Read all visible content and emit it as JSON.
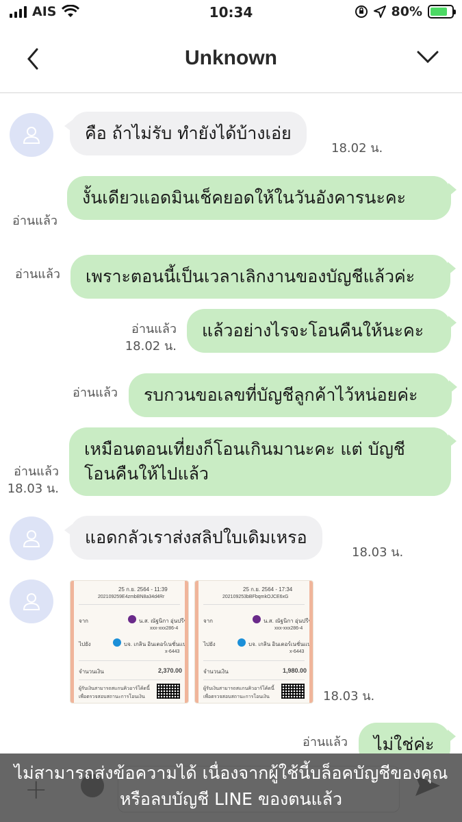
{
  "status_bar": {
    "carrier": "AIS",
    "time": "10:34",
    "battery": "80%",
    "battery_level": 0.8
  },
  "header": {
    "title": "Unknown"
  },
  "messages": [
    {
      "side": "in",
      "text": "คือ ถ้าไม่รับ ทำยังได้บ้างเอ่ย",
      "time": "18.02 น."
    },
    {
      "side": "out",
      "text": "งั้นเดียวแอดมินเช็คยอดให้ในวันอังคารนะคะ",
      "read": "อ่านแล้ว"
    },
    {
      "side": "out",
      "text": "เพราะตอนนี้เป็นเวลาเลิกงานของบัญชีแล้วค่ะ",
      "read": "อ่านแล้ว"
    },
    {
      "side": "out",
      "text": "แล้วอย่างไรจะโอนคืนให้นะคะ",
      "read": "อ่านแล้ว",
      "time": "18.02 น."
    },
    {
      "side": "out",
      "text": "รบกวนขอเลขที่บัญชีลูกค้าไว้หน่อยค่ะ",
      "read": "อ่านแล้ว"
    },
    {
      "side": "out",
      "text": "เหมือนตอนเที่ยงก็โอนเกินมานะคะ แต่ บัญชีโอนคืนให้ไปแล้ว",
      "read": "อ่านแล้ว",
      "time": "18.03 น."
    },
    {
      "side": "in",
      "text": "แอดกลัวเราส่งสลิปใบเดิมเหรอ",
      "time": "18.03 น."
    },
    {
      "side": "in",
      "type": "image",
      "time": "18.03 น."
    },
    {
      "side": "out",
      "text": "ไม่ใช่ค่ะ",
      "read": "อ่านแล้ว"
    }
  ],
  "slips": [
    {
      "date": "25 ก.ย. 2564 - 11:39",
      "ref": "202109259E4zmbBN8a34d4Rr",
      "from_label": "จาก",
      "from_name": "น.ส. ณัฐนิกา อุ่นปรีชาวณิชย์",
      "from_acct": "xxx-xxx286-4",
      "to_label": "ไปยัง",
      "to_name": "บจ. เกลิน อินเตอร์เนชั่นแนล",
      "to_acct": "x-6443",
      "amount_label": "จำนวนเงิน",
      "amount": "2,370.00",
      "note1": "ผู้รับเงินสามารถสแกนคิวอาร์โค้ดนี้",
      "note2": "เพื่อตรวจสอบสถานะการโอนเงิน"
    },
    {
      "date": "25 ก.ย. 2564 - 17:34",
      "ref": "202109253bBFbqmkOJCE6xG",
      "from_label": "จาก",
      "from_name": "น.ส. ณัฐนิกา อุ่นปรีชาวณิชย์",
      "from_acct": "xxx-xxx286-4",
      "to_label": "ไปยัง",
      "to_name": "บจ. เกลิน อินเตอร์เนชั่นแนล",
      "to_acct": "x-6443",
      "amount_label": "จำนวนเงิน",
      "amount": "1,980.00",
      "note1": "ผู้รับเงินสามารถสแกนคิวอาร์โค้ดนี้",
      "note2": "เพื่อตรวจสอบสถานะการโอนเงิน"
    }
  ],
  "composer": {
    "blocked_notice": "ไม่สามารถส่งข้อความได้ เนื่องจากผู้ใช้นี้บล็อคบัญชีของคุณหรือลบบัญชี LINE ของตนแล้ว"
  },
  "colors": {
    "outgoing_bubble": "#c9ecc4",
    "incoming_bubble": "#f0f0f2",
    "avatar_bg": "#dde3f6",
    "battery_fill": "#4cd964"
  }
}
